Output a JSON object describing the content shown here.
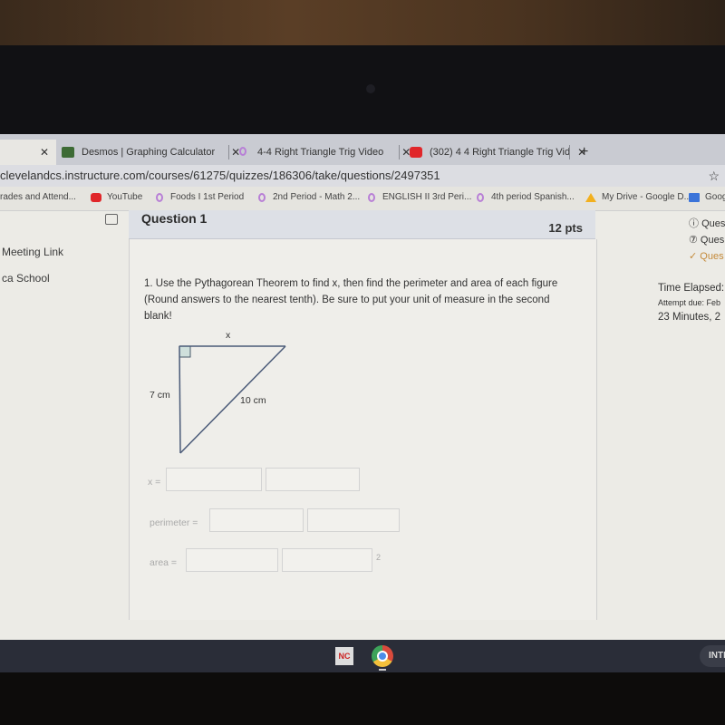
{
  "browser": {
    "tabs": [
      {
        "label": "",
        "close": "✕",
        "active": true
      },
      {
        "label": "Desmos | Graphing Calculator",
        "icon": "desmos-icon",
        "close": "✕"
      },
      {
        "label": "4-4 Right Triangle Trig Video",
        "icon": "canvas-icon",
        "close": "✕"
      },
      {
        "label": "(302) 4 4 Right Triangle Trig Vid",
        "icon": "youtube-icon",
        "close": "✕"
      }
    ],
    "new_tab": "+",
    "url": "clevelandcs.instructure.com/courses/61275/quizzes/186306/take/questions/2497351",
    "star": "☆",
    "bookmarks": [
      {
        "label": "rades and Attend...",
        "icon": ""
      },
      {
        "label": "YouTube",
        "icon": "youtube-icon"
      },
      {
        "label": "Foods I 1st Period",
        "icon": "canvas-icon"
      },
      {
        "label": "2nd Period - Math 2...",
        "icon": "canvas-icon"
      },
      {
        "label": "ENGLISH II 3rd Peri...",
        "icon": "canvas-icon"
      },
      {
        "label": "4th period Spanish...",
        "icon": "canvas-icon"
      },
      {
        "label": "My Drive - Google D...",
        "icon": "google-drive-icon"
      },
      {
        "label": "Goog",
        "icon": "google-docs-icon"
      }
    ]
  },
  "left_nav": {
    "items": [
      "Meeting Link",
      "ca School"
    ]
  },
  "question": {
    "title": "Question 1",
    "points": "12 pts",
    "text": "1. Use the Pythagorean Theorem to find x, then find the perimeter and area of each figure (Round answers to the nearest tenth). Be sure to put your unit of measure in the second blank!",
    "figure": {
      "top_label": "x",
      "left_label": "7 cm",
      "hyp_label": "10 cm"
    },
    "fields": [
      {
        "label": "x =",
        "value1": "",
        "value2": "",
        "suffix": ""
      },
      {
        "label": "perimeter =",
        "value1": "",
        "value2": "",
        "suffix": ""
      },
      {
        "label": "area =",
        "value1": "",
        "value2": "",
        "suffix": "2"
      }
    ]
  },
  "right_sidebar": {
    "items": [
      {
        "icon": "question-circle-icon",
        "label": "Ques"
      },
      {
        "icon": "question-circle-icon",
        "label": "Ques"
      },
      {
        "icon": "check-icon",
        "label": "Ques"
      }
    ],
    "time_elapsed_label": "Time Elapsed:",
    "attempt_due": "Attempt due: Feb",
    "time_value": "23 Minutes, 2"
  },
  "taskbar": {
    "nc_label": "NC",
    "pill_label": "INTL"
  }
}
